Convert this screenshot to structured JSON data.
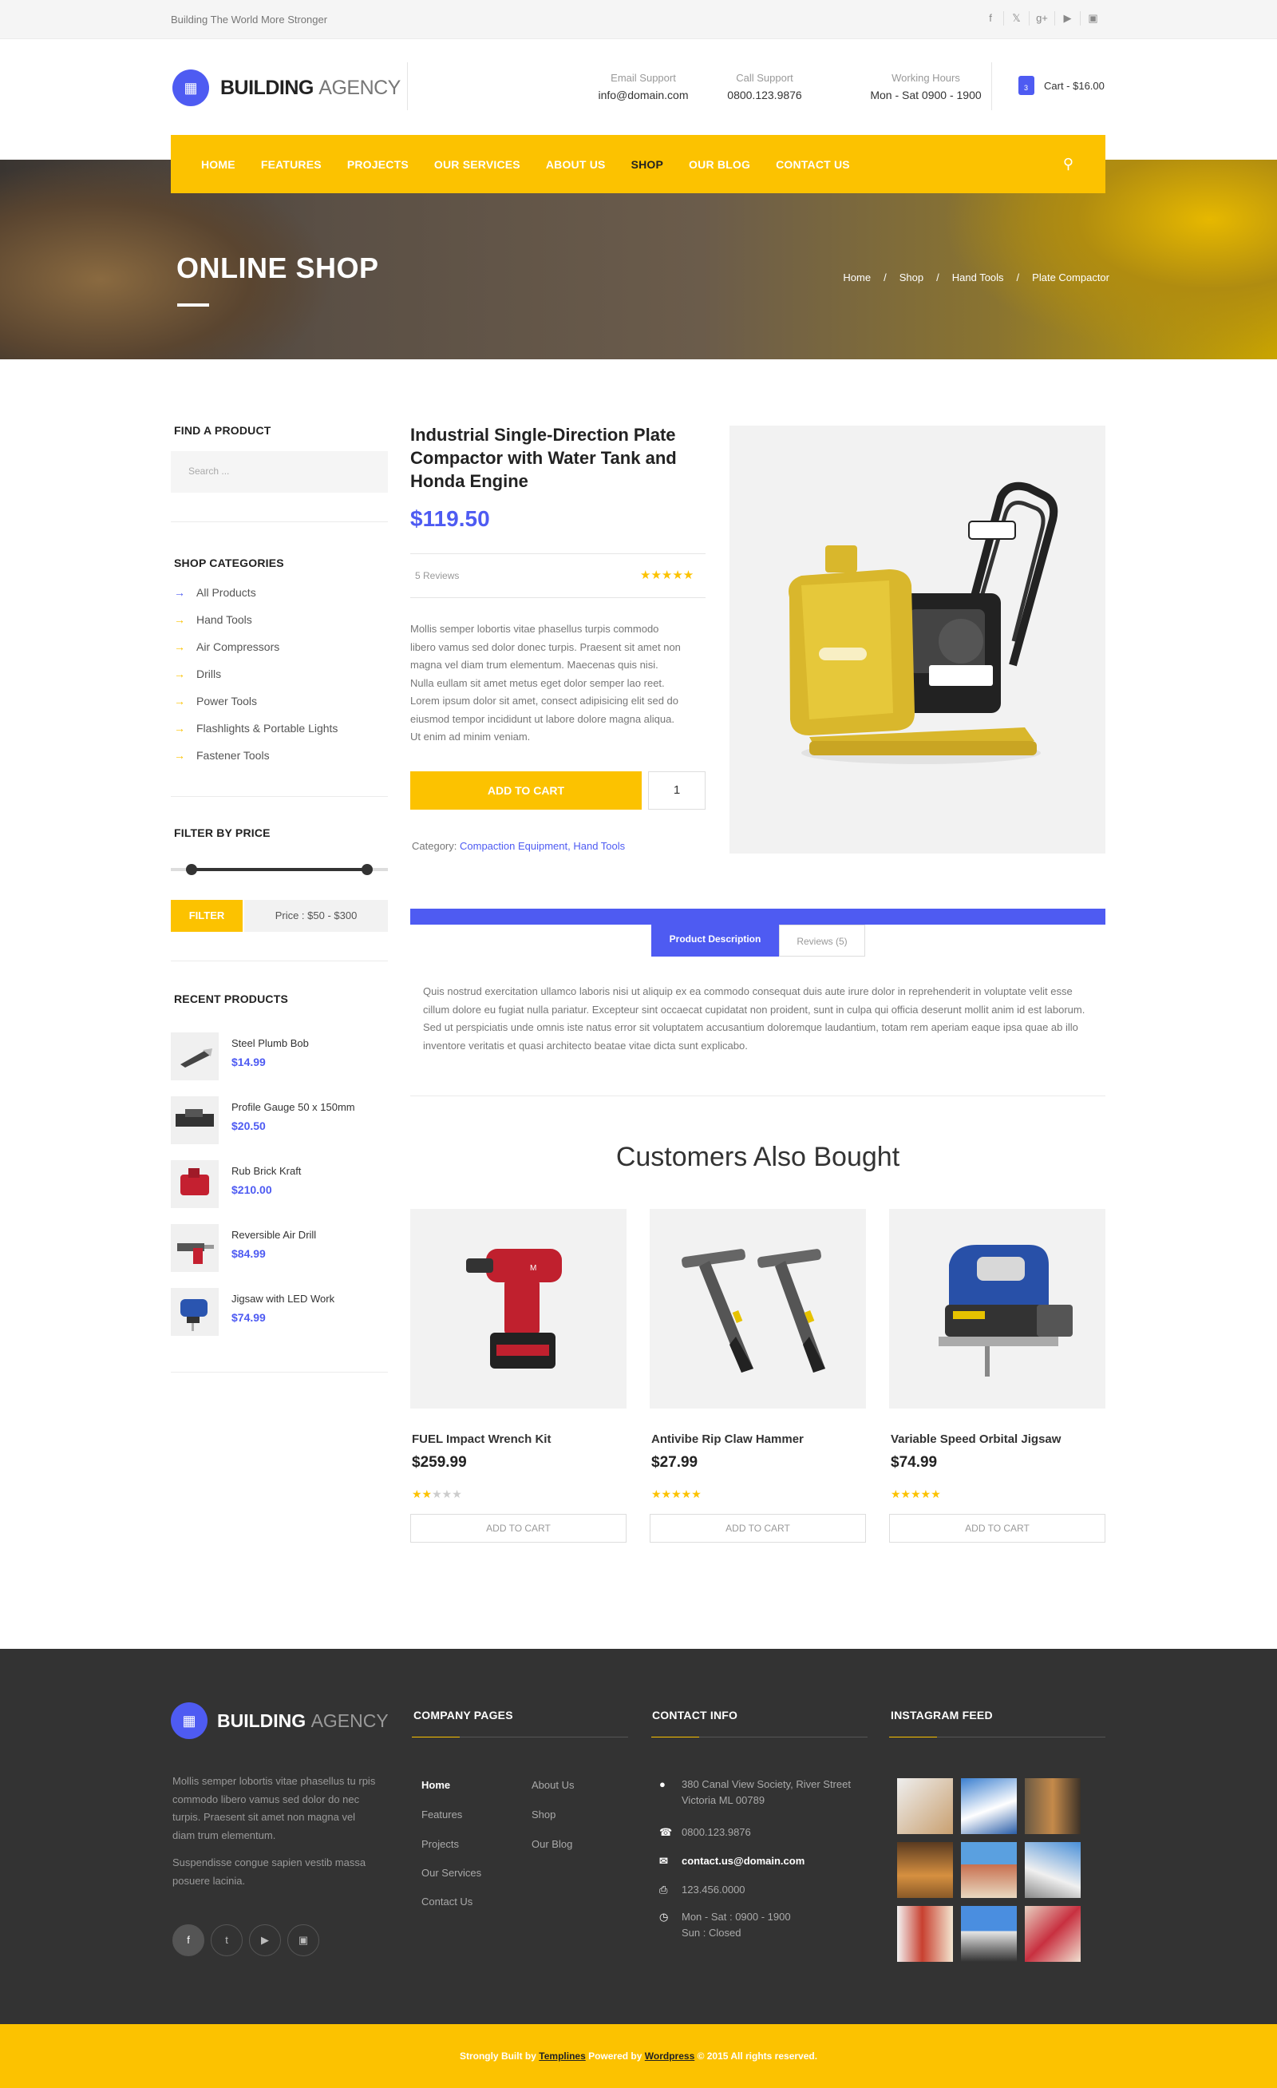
{
  "topbar": {
    "tagline": "Building The World More Stronger",
    "social": [
      "f",
      "’",
      "g+",
      "▶",
      "▣"
    ]
  },
  "header": {
    "logo_main": "BUILDING",
    "logo_sub": "AGENCY",
    "info": [
      {
        "label": "Email Support",
        "value": "info@domain.com"
      },
      {
        "label": "Call Support",
        "value": "0800.123.9876"
      },
      {
        "label": "Working Hours",
        "value": "Mon - Sat 0900 - 1900"
      }
    ],
    "cart": "Cart - $16.00",
    "cart_count": "3"
  },
  "nav": {
    "items": [
      "HOME",
      "FEATURES",
      "PROJECTS",
      "OUR SERVICES",
      "ABOUT US",
      "SHOP",
      "OUR BLOG",
      "CONTACT US"
    ],
    "active": "SHOP"
  },
  "hero": {
    "title": "ONLINE SHOP",
    "breadcrumb": [
      "Home",
      "/",
      "Shop",
      "/",
      "Hand Tools",
      "/",
      "Plate Compactor"
    ]
  },
  "sidebar": {
    "find_title": "FIND A PRODUCT",
    "search_placeholder": "Search ...",
    "cat_title": "SHOP CATEGORIES",
    "categories": [
      "All  Products",
      "Hand Tools",
      "Air Compressors",
      "Drills",
      "Power Tools",
      "Flashlights & Portable Lights",
      "Fastener Tools"
    ],
    "price_title": "FILTER BY PRICE",
    "filter_btn": "FILTER",
    "price_range": "Price :  $50  -  $300",
    "price_slider": {
      "min": 50,
      "max": 300
    },
    "recent_title": "RECENT PRODUCTS",
    "recent": [
      {
        "name": "Steel Plumb Bob",
        "price": "$14.99"
      },
      {
        "name": "Profile Gauge 50 x 150mm",
        "price": "$20.50"
      },
      {
        "name": "Rub Brick Kraft",
        "price": "$210.00"
      },
      {
        "name": "Reversible Air Drill",
        "price": "$84.99"
      },
      {
        "name": "Jigsaw with LED Work",
        "price": "$74.99"
      }
    ]
  },
  "product": {
    "title": "Industrial Single-Direction Plate Compactor with Water Tank and Honda Engine",
    "price": "$119.50",
    "reviews": "5 Reviews",
    "rating": 5,
    "stars": "★★★★★",
    "description": "Mollis semper lobortis vitae phasellus turpis commodo libero vamus sed dolor donec turpis. Praesent sit amet non magna vel diam trum elementum. Maecenas quis nisi. Nulla eullam sit amet metus eget dolor semper lao reet. Lorem ipsum dolor sit amet, consect adipisicing elit sed do eiusmod tempor incididunt ut labore dolore magna aliqua. Ut enim ad minim veniam.",
    "add_to_cart": "ADD TO CART",
    "qty": "1",
    "category_label": "Category:",
    "categories": "Compaction Equipment, Hand Tools"
  },
  "tabs": {
    "active": "Product Description",
    "other": "Reviews (5)",
    "text": "Quis nostrud exercitation ullamco laboris nisi ut aliquip ex ea commodo consequat duis aute irure dolor in reprehenderit in voluptate velit esse cillum dolore eu fugiat nulla pariatur. Excepteur sint occaecat cupidatat non proident, sunt in culpa qui officia deserunt mollit anim id est laborum. Sed ut perspiciatis unde omnis iste natus error sit voluptatem accusantium doloremque laudantium, totam rem aperiam eaque ipsa quae ab illo inventore veritatis et quasi architecto beatae vitae dicta sunt explicabo."
  },
  "also": {
    "title": "Customers Also Bought",
    "items": [
      {
        "name": "FUEL Impact Wrench Kit",
        "price": "$259.99",
        "stars_on": "★★",
        "stars_off": "★★★",
        "rating": 2,
        "btn": "ADD TO CART"
      },
      {
        "name": "Antivibe Rip Claw Hammer",
        "price": "$27.99",
        "stars_on": "★★★★★",
        "stars_off": "",
        "rating": 5,
        "btn": "ADD TO CART"
      },
      {
        "name": "Variable Speed Orbital Jigsaw",
        "price": "$74.99",
        "stars_on": "★★★★★",
        "stars_off": "",
        "rating": 5,
        "btn": "ADD TO CART"
      }
    ]
  },
  "footer": {
    "logo_main": "BUILDING",
    "logo_sub": "AGENCY",
    "about1": "Mollis semper lobortis vitae phasellus tu rpis commodo libero vamus sed dolor do nec turpis. Praesent sit amet non magna vel diam trum elementum.",
    "about2": "Suspendisse congue sapien vestib massa posuere lacinia.",
    "social": [
      "f",
      "t",
      "▶",
      "▣"
    ],
    "pages_title": "COMPANY PAGES",
    "pages_col1": [
      "Home",
      "Features",
      "Projects",
      "Our Services",
      "Contact Us"
    ],
    "pages_col2": [
      "About Us",
      "Shop",
      "Our Blog"
    ],
    "contact_title": "CONTACT INFO",
    "address1": "380 Canal View Society, River Street",
    "address2": "Victoria ML 00789",
    "phone": "0800.123.9876",
    "email": "contact.us@domain.com",
    "fax": "123.456.0000",
    "hours1": "Mon - Sat : 0900 - 1900",
    "hours2": "Sun : Closed",
    "insta_title": "INSTAGRAM FEED",
    "copyright_pre": "Strongly Built by ",
    "copyright_link1": "Templines",
    "copyright_mid": " Powered by ",
    "copyright_link2": "Wordpress",
    "copyright_post": "  © 2015 All rights reserved."
  },
  "colors": {
    "accent": "#fcc200",
    "brand": "#4e5bf2",
    "dark": "#333333"
  }
}
